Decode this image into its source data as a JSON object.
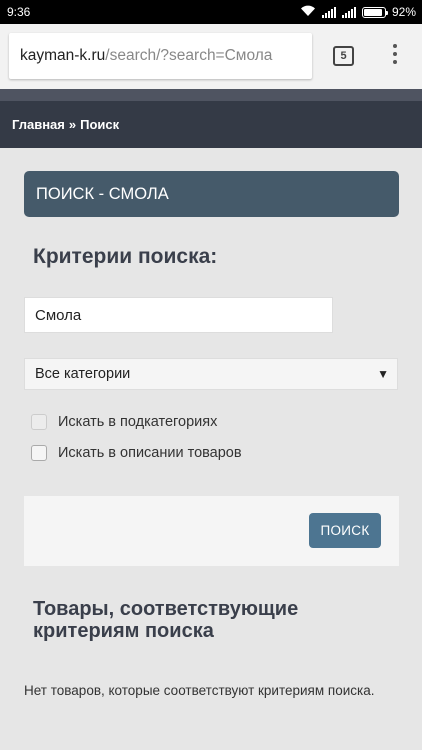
{
  "status_bar": {
    "time": "9:36",
    "battery_text": "92%",
    "battery_level": 0.92,
    "icons": [
      "wifi-icon",
      "signal-icon",
      "signal-icon",
      "battery-icon"
    ]
  },
  "browser": {
    "url_host": "kayman-k.ru",
    "url_path": "/search/?search=Смола",
    "tab_count": "5",
    "menu_icon": "more-vert-icon"
  },
  "breadcrumb": {
    "home": "Главная",
    "separator": "»",
    "current": "Поиск"
  },
  "page": {
    "heading": "ПОИСК - СМОЛА",
    "criteria_title": "Критерии поиска:",
    "search_value": "Смола",
    "category_selected": "Все категории",
    "checkbox_subcategories": "Искать в подкатегориях",
    "checkbox_description": "Искать в описании товаров",
    "search_button": "ПОИСК",
    "results_title": "Товары, соответствующие критериям поиска",
    "no_results": "Нет товаров, которые соответствуют критериям поиска."
  },
  "colors": {
    "heading_bg": "#455a6a",
    "breadcrumb_bg": "#343a46",
    "button_bg": "#4d7591"
  }
}
